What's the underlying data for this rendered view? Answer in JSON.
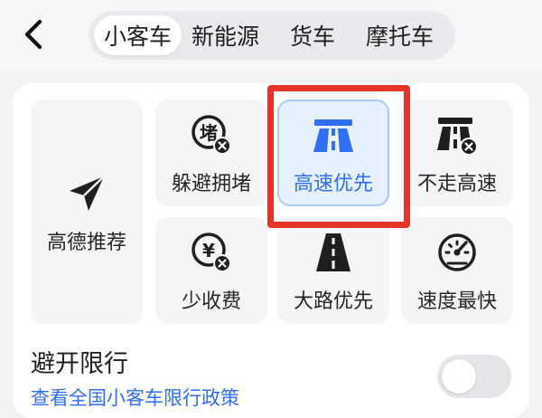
{
  "header": {
    "back_icon": "chevron-left-icon",
    "tabs": [
      {
        "label": "小客车",
        "active": true
      },
      {
        "label": "新能源",
        "active": false
      },
      {
        "label": "货车",
        "active": false
      },
      {
        "label": "摩托车",
        "active": false
      }
    ]
  },
  "route_options": {
    "recommend": {
      "label": "高德推荐",
      "icon": "paper-plane-icon"
    },
    "avoid_congestion": {
      "label": "躲避拥堵",
      "icon": "congestion-avoid-icon"
    },
    "highway_first": {
      "label": "高速优先",
      "icon": "highway-icon",
      "selected": true
    },
    "no_highway": {
      "label": "不走高速",
      "icon": "no-highway-icon"
    },
    "less_toll": {
      "label": "少收费",
      "icon": "toll-avoid-icon"
    },
    "main_road_first": {
      "label": "大路优先",
      "icon": "main-road-icon"
    },
    "fastest": {
      "label": "速度最快",
      "icon": "speedometer-icon"
    }
  },
  "restriction": {
    "title": "避开限行",
    "link": "查看全国小客车限行政策",
    "enabled": false
  },
  "colors": {
    "accent": "#2f6ff5",
    "highlight": "#e4342a",
    "icon_dark": "#1f1f1f"
  }
}
